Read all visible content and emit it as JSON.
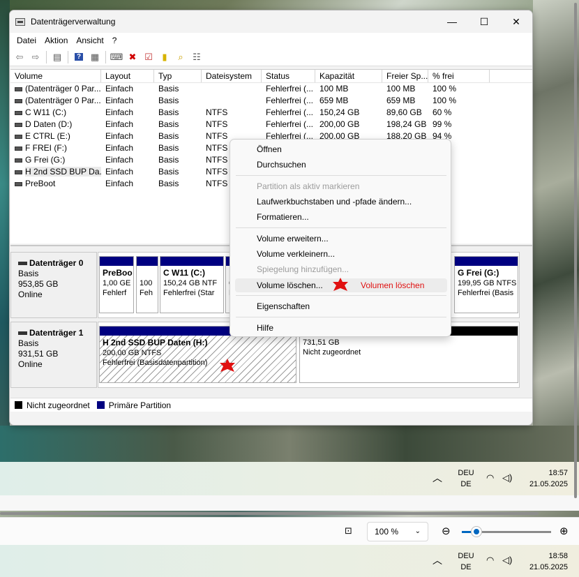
{
  "window": {
    "title": "Datenträgerverwaltung",
    "controls": {
      "minimize": "—",
      "maximize": "☐",
      "close": "✕"
    }
  },
  "menu": [
    "Datei",
    "Aktion",
    "Ansicht",
    "?"
  ],
  "toolbar_icons": [
    "back-icon",
    "forward-icon",
    "properties-icon",
    "help-icon",
    "console-icon",
    "connect-icon",
    "delete-icon",
    "check-icon",
    "new-icon",
    "search-icon",
    "list-icon"
  ],
  "volume_list": {
    "columns": [
      "Volume",
      "Layout",
      "Typ",
      "Dateisystem",
      "Status",
      "Kapazität",
      "Freier Sp...",
      "% frei"
    ],
    "rows": [
      [
        "(Datenträger 0 Par...",
        "Einfach",
        "Basis",
        "",
        "Fehlerfrei (...",
        "100 MB",
        "100 MB",
        "100 %"
      ],
      [
        "(Datenträger 0 Par...",
        "Einfach",
        "Basis",
        "",
        "Fehlerfrei (...",
        "659 MB",
        "659 MB",
        "100 %"
      ],
      [
        "C W11 (C:)",
        "Einfach",
        "Basis",
        "NTFS",
        "Fehlerfrei (...",
        "150,24 GB",
        "89,60 GB",
        "60 %"
      ],
      [
        "D Daten (D:)",
        "Einfach",
        "Basis",
        "NTFS",
        "Fehlerfrei (...",
        "200,00 GB",
        "198,24 GB",
        "99 %"
      ],
      [
        "E CTRL (E:)",
        "Einfach",
        "Basis",
        "NTFS",
        "Fehlerfrei (...",
        "200,00 GB",
        "188,20 GB",
        "94 %"
      ],
      [
        "F FREI (F:)",
        "Einfach",
        "Basis",
        "NTFS",
        "",
        "",
        "",
        "s"
      ],
      [
        "G Frei (G:)",
        "Einfach",
        "Basis",
        "NTFS",
        "",
        "",
        "",
        ""
      ],
      [
        "H 2nd SSD BUP Da...",
        "Einfach",
        "Basis",
        "NTFS",
        "",
        "",
        "",
        ""
      ],
      [
        "PreBoot",
        "Einfach",
        "Basis",
        "NTFS",
        "",
        "",
        "",
        ""
      ]
    ]
  },
  "disks": [
    {
      "name": "Datenträger 0",
      "type": "Basis",
      "size": "953,85 GB",
      "status": "Online",
      "partitions": [
        {
          "title": "PreBoo",
          "line1": "1,00 GE",
          "line2": "Fehlerf"
        },
        {
          "title": "",
          "line1": "100",
          "line2": "Feh"
        },
        {
          "title": "C W11  (C:)",
          "line1": "150,24 GB NTF",
          "line2": "Fehlerfrei (Star"
        },
        {
          "title": "",
          "line1": "6",
          "line2": "F"
        },
        {
          "title": "G Frei  (G:)",
          "line1": "199,95 GB NTFS",
          "line2": "Fehlerfrei (Basis"
        }
      ]
    },
    {
      "name": "Datenträger 1",
      "type": "Basis",
      "size": "931,51 GB",
      "status": "Online",
      "partitions": [
        {
          "title": "H 2nd SSD BUP Daten  (H:)",
          "line1": "200,00 GB NTFS",
          "line2": "Fehlerfrei (Basisdatenpartition)"
        },
        {
          "title": "",
          "line1": "731,51 GB",
          "line2": "Nicht zugeordnet"
        }
      ]
    }
  ],
  "legend": {
    "unallocated": "Nicht zugeordnet",
    "primary": "Primäre Partition",
    "unallocated_color": "#000000",
    "primary_color": "#000080"
  },
  "context_menu": {
    "items": [
      {
        "label": "Öffnen",
        "enabled": true
      },
      {
        "label": "Durchsuchen",
        "enabled": true
      },
      {
        "label": "Partition als aktiv markieren",
        "enabled": false
      },
      {
        "label": "Laufwerkbuchstaben und -pfade ändern...",
        "enabled": true
      },
      {
        "label": "Formatieren...",
        "enabled": true
      },
      {
        "label": "Volume erweitern...",
        "enabled": true
      },
      {
        "label": "Volume verkleinern...",
        "enabled": true
      },
      {
        "label": "Spiegelung hinzufügen...",
        "enabled": false
      },
      {
        "label": "Volume löschen...",
        "enabled": true,
        "highlighted": true
      },
      {
        "label": "Eigenschaften",
        "enabled": true
      },
      {
        "label": "Hilfe",
        "enabled": true
      }
    ]
  },
  "annotation": {
    "text": "Volumen löschen",
    "color": "#e01010"
  },
  "taskbar_top": {
    "lang": "DEU",
    "region": "DE",
    "time": "18:57",
    "date": "21.05.2025"
  },
  "viewer": {
    "zoom": "100 %",
    "zoom_level_percent": 15
  },
  "taskbar_bottom": {
    "lang": "DEU",
    "region": "DE",
    "time": "18:58",
    "date": "21.05.2025"
  }
}
